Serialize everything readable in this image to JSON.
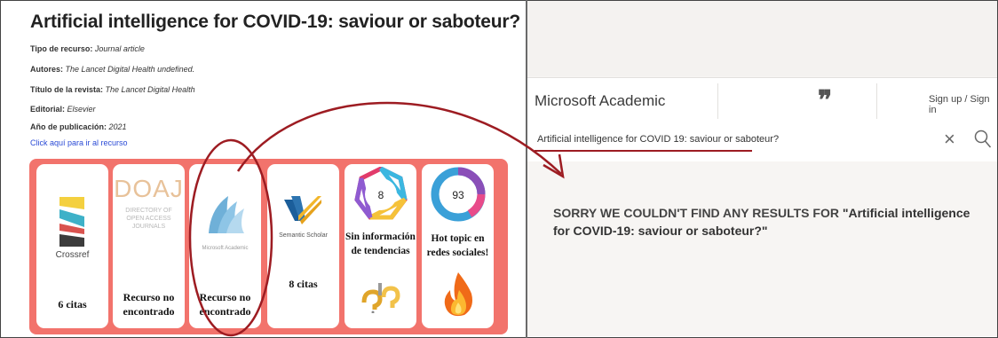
{
  "resource": {
    "title": "Artificial intelligence for COVID-19: saviour or saboteur?",
    "meta": [
      {
        "label": "Tipo de recurso:",
        "value": "Journal article"
      },
      {
        "label": "Autores:",
        "value": "The Lancet Digital Health undefined."
      },
      {
        "label": "Título de la revista:",
        "value": "The Lancet Digital Health"
      },
      {
        "label": "Editorial:",
        "value": "Elsevier"
      },
      {
        "label": "Año de publicación:",
        "value": "2021"
      }
    ],
    "link": "Click aquí para ir al recurso"
  },
  "cards": {
    "crossref": {
      "logo_text": "Crossref",
      "label": "6 citas"
    },
    "doaj": {
      "logo_text": "DOAJ",
      "logo_sub_1": "DIRECTORY OF",
      "logo_sub_2": "OPEN ACCESS",
      "logo_sub_3": "JOURNALS",
      "label_1": "Recurso no",
      "label_2": "encontrado"
    },
    "microsoft": {
      "logo_text": "Microsoft Academic",
      "label_1": "Recurso no",
      "label_2": "encontrado"
    },
    "semantic": {
      "logo_text": "Semantic Scholar",
      "label": "8 citas"
    },
    "trends": {
      "badge": "8",
      "label_1": "Sin información",
      "label_2": "de tendencias"
    },
    "altmetric": {
      "badge": "93",
      "label_1": "Hot topic en",
      "label_2": "redes sociales!"
    }
  },
  "academic": {
    "brand": "Microsoft Academic",
    "quote_icon": "❞",
    "signin": "Sign up / Sign in",
    "search_query": "Artificial intelligence for COVID 19: saviour or saboteur?",
    "message_prefix": "SORRY WE COULDN'T FIND ANY RESULTS FOR ",
    "message_query": "\"Artificial intelligence for COVID-19: saviour or saboteur?\""
  },
  "colors": {
    "panel": "#f2736c",
    "annotation": "#9d1c22",
    "link": "#2b4bd6"
  },
  "icons": [
    "crossref-logo",
    "doaj-logo",
    "microsoft-academic-logo",
    "semantic-scholar-logo",
    "trends-heptagon-icon",
    "altmetric-donut-icon",
    "question-icon",
    "fire-icon",
    "close-icon",
    "search-icon"
  ]
}
